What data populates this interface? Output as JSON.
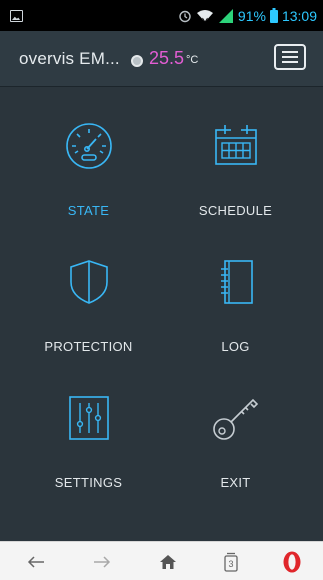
{
  "status_bar": {
    "battery_percent": "91%",
    "time": "13:09",
    "accent_color": "#2dc8ff"
  },
  "app_bar": {
    "title": "overvis EM...",
    "temperature": "25.5",
    "temperature_unit": "°C",
    "temperature_color": "#e25dd3",
    "menu_icon": "hamburger-icon"
  },
  "tiles": [
    {
      "id": "state",
      "label": "STATE",
      "icon": "speedometer-icon",
      "active": true
    },
    {
      "id": "schedule",
      "label": "SCHEDULE",
      "icon": "calendar-icon",
      "active": false
    },
    {
      "id": "protection",
      "label": "PROTECTION",
      "icon": "shield-icon",
      "active": false
    },
    {
      "id": "log",
      "label": "LOG",
      "icon": "notebook-icon",
      "active": false
    },
    {
      "id": "settings",
      "label": "SETTINGS",
      "icon": "sliders-icon",
      "active": false
    },
    {
      "id": "exit",
      "label": "EXIT",
      "icon": "key-icon",
      "active": false
    }
  ],
  "colors": {
    "background": "#2b353c",
    "icon_stroke": "#39b7f5",
    "active_label": "#39b7f5"
  },
  "browser_nav": {
    "tabs_count": "3",
    "icons": [
      "back-arrow-icon",
      "forward-arrow-icon",
      "home-icon",
      "tabs-icon",
      "opera-logo-icon"
    ]
  }
}
